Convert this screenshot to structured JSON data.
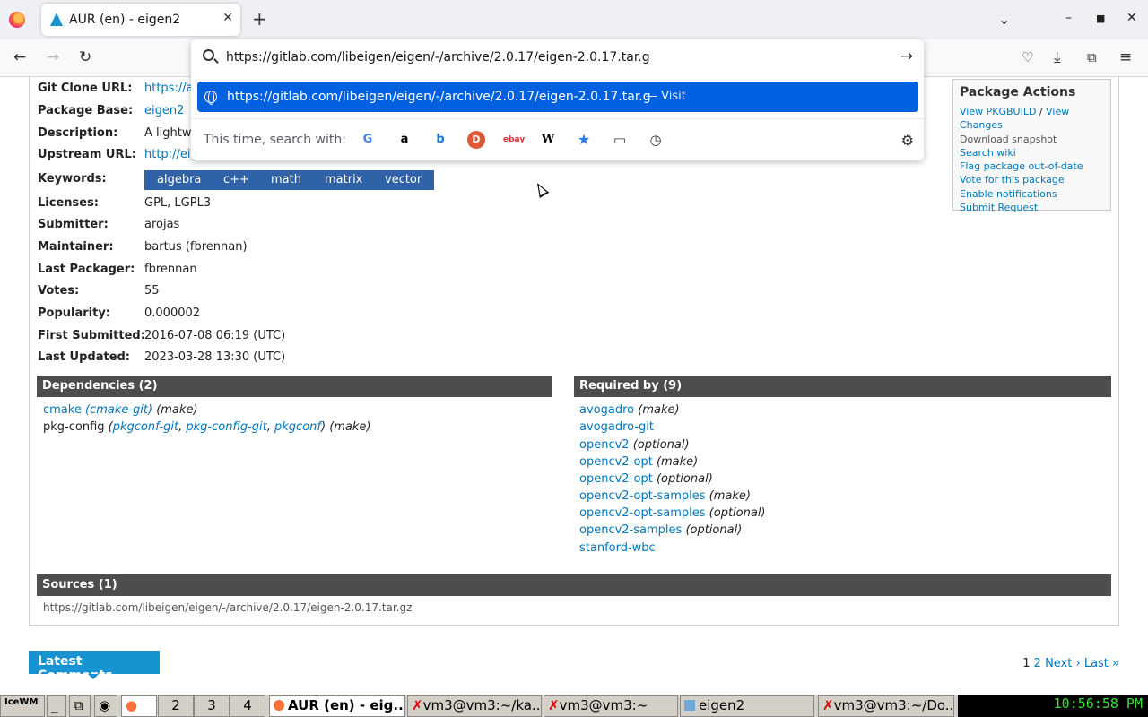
{
  "browser": {
    "tab_title": "AUR (en) - eigen2",
    "url_value": "https://gitlab.com/libeigen/eigen/-/archive/2.0.17/eigen-2.0.17.tar.g",
    "suggestion": "https://gitlab.com/libeigen/eigen/-/archive/2.0.17/eigen-2.0.17.tar.g",
    "suggestion_action": "— Visit",
    "search_with_label": "This time, search with:"
  },
  "package": {
    "rows": [
      {
        "label": "Git Clone URL:",
        "value": "https://au"
      },
      {
        "label": "Package Base:",
        "value": "eigen2"
      },
      {
        "label": "Description:",
        "value": "A lightwe"
      },
      {
        "label": "Upstream URL:",
        "value": "http://eige"
      },
      {
        "label": "Keywords:",
        "value": ""
      },
      {
        "label": "Licenses:",
        "value": "GPL, LGPL3"
      },
      {
        "label": "Submitter:",
        "value": "arojas"
      },
      {
        "label": "Maintainer:",
        "value": "bartus (fbrennan)"
      },
      {
        "label": "Last Packager:",
        "value": "fbrennan"
      },
      {
        "label": "Votes:",
        "value": "55"
      },
      {
        "label": "Popularity:",
        "value": "0.000002"
      },
      {
        "label": "First Submitted:",
        "value": "2016-07-08 06:19 (UTC)"
      },
      {
        "label": "Last Updated:",
        "value": "2023-03-28 13:30 (UTC)"
      }
    ],
    "keywords": [
      "algebra",
      "c++",
      "math",
      "matrix",
      "vector"
    ]
  },
  "actions": {
    "title": "Package Actions",
    "view_pkgbuild": "View PKGBUILD",
    "sep": " / ",
    "view_changes": "View Changes",
    "download_snapshot": "Download snapshot",
    "search_wiki": "Search wiki",
    "flag": "Flag package out-of-date",
    "vote": "Vote for this package",
    "notify": "Enable notifications",
    "submit": "Submit Request"
  },
  "dependencies": {
    "title": "Dependencies (2)",
    "items": [
      {
        "name": "cmake",
        "alts": "(cmake-git)",
        "type": "(make)"
      },
      {
        "name": "pkg-config",
        "alts": [
          "pkgconf-git",
          "pkg-config-git",
          "pkgconf"
        ],
        "type": "(make)"
      }
    ]
  },
  "required_by": {
    "title": "Required by (9)",
    "items": [
      {
        "name": "avogadro",
        "type": "(make)"
      },
      {
        "name": "avogadro-git",
        "type": ""
      },
      {
        "name": "opencv2",
        "type": "(optional)"
      },
      {
        "name": "opencv2-opt",
        "type": "(make)"
      },
      {
        "name": "opencv2-opt",
        "type": "(optional)"
      },
      {
        "name": "opencv2-opt-samples",
        "type": "(make)"
      },
      {
        "name": "opencv2-opt-samples",
        "type": "(optional)"
      },
      {
        "name": "opencv2-samples",
        "type": "(optional)"
      },
      {
        "name": "stanford-wbc",
        "type": ""
      }
    ]
  },
  "sources": {
    "title": "Sources (1)",
    "url": "https://gitlab.com/libeigen/eigen/-/archive/2.0.17/eigen-2.0.17.tar.gz"
  },
  "comments": {
    "title": "Latest Comments",
    "page1": "1",
    "page2": "2",
    "next": "Next ›",
    "last": "Last »"
  },
  "taskbar": {
    "desk1": "2",
    "desk2": "3",
    "desk3": "4",
    "win1": "AUR (en) - eig...",
    "win2": "vm3@vm3:~/ka...",
    "win3": "vm3@vm3:~",
    "win4": "eigen2",
    "win5": "vm3@vm3:~/Do...",
    "clock": "10:56:58 PM"
  }
}
